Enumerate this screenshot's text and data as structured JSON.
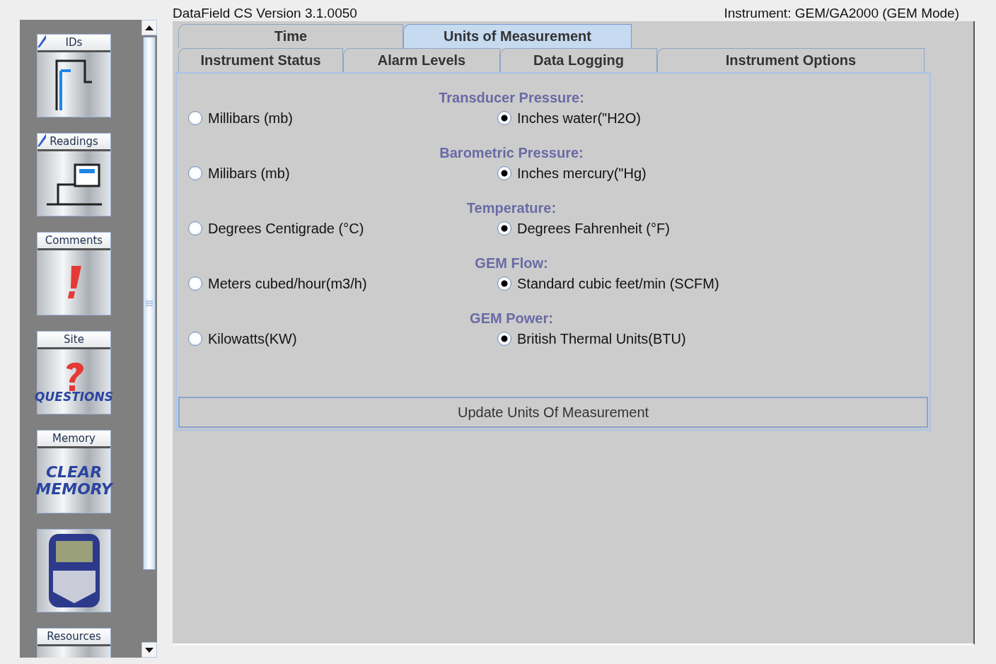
{
  "header": {
    "version": "DataField CS Version 3.1.0050",
    "instrument": "Instrument: GEM/GA2000 (GEM Mode)"
  },
  "sidebar": {
    "tiles": [
      {
        "kind": "ids",
        "label": "IDs",
        "checked": true
      },
      {
        "kind": "readings",
        "label": "Readings",
        "checked": true
      },
      {
        "kind": "comments",
        "label": "Comments",
        "checked": false
      },
      {
        "kind": "site",
        "label": "Site",
        "checked": false,
        "art_text": "QUESTIONS"
      },
      {
        "kind": "memory",
        "label": "Memory",
        "checked": false,
        "art_text": "CLEAR MEMORY"
      },
      {
        "kind": "device",
        "checked": false
      },
      {
        "kind": "resources",
        "label": "Resources",
        "checked": false
      }
    ]
  },
  "tab_rows": [
    [
      {
        "label": "Time",
        "selected": false
      },
      {
        "label": "Units of Measurement",
        "selected": true
      }
    ],
    [
      {
        "label": "Instrument Status",
        "selected": false
      },
      {
        "label": "Alarm Levels",
        "selected": false
      },
      {
        "label": "Data Logging",
        "selected": false
      },
      {
        "label": "Instrument Options",
        "selected": false
      }
    ]
  ],
  "groups": [
    {
      "heading": "Transducer Pressure:",
      "options": [
        {
          "label": "Millibars (mb)",
          "selected": false
        },
        {
          "label": "Inches water(\"H2O)",
          "selected": true
        }
      ]
    },
    {
      "heading": "Barometric Pressure:",
      "options": [
        {
          "label": "Milibars (mb)",
          "selected": false
        },
        {
          "label": "Inches mercury(\"Hg)",
          "selected": true
        }
      ]
    },
    {
      "heading": "Temperature:",
      "options": [
        {
          "label": "Degrees Centigrade (°C)",
          "selected": false
        },
        {
          "label": "Degrees Fahrenheit (°F)",
          "selected": true
        }
      ]
    },
    {
      "heading": "GEM Flow:",
      "options": [
        {
          "label": "Meters cubed/hour(m3/h)",
          "selected": false
        },
        {
          "label": "Standard cubic feet/min (SCFM)",
          "selected": true
        }
      ]
    },
    {
      "heading": "GEM Power:",
      "options": [
        {
          "label": "Kilowatts(KW)",
          "selected": false
        },
        {
          "label": "British Thermal Units(BTU)",
          "selected": true
        }
      ]
    }
  ],
  "update_button": "Update Units Of Measurement"
}
